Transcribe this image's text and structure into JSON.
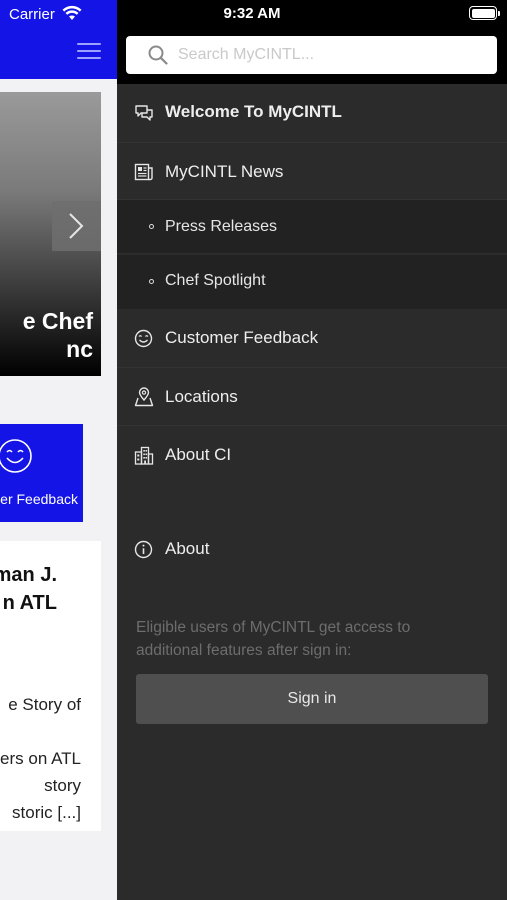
{
  "status_bar": {
    "carrier": "Carrier",
    "time": "9:32 AM"
  },
  "app": {
    "hero": {
      "title_visible": "e Chef\nnc"
    },
    "feedback_tile": {
      "label_visible": "er Feedback",
      "icon": "smile-icon"
    },
    "news_card": {
      "title_visible": "man J.\nn ATL",
      "excerpt_visible": "e Story of\n\ners on ATL\nstory\nstoric [...]"
    },
    "colors": {
      "brand_blue": "#1414e6",
      "header_icon": "#9ea2ff"
    }
  },
  "drawer": {
    "search": {
      "placeholder": "Search MyCINTL..."
    },
    "menu": [
      {
        "label": "Welcome To MyCINTL",
        "icon": "chat-bubbles-icon",
        "bold": true
      },
      {
        "label": "MyCINTL News",
        "icon": "newspaper-icon"
      },
      {
        "label": "Press Releases",
        "sub": true
      },
      {
        "label": "Chef Spotlight",
        "sub": true
      },
      {
        "label": "Customer Feedback",
        "icon": "smile-icon"
      },
      {
        "label": "Locations",
        "icon": "map-pin-icon"
      },
      {
        "label": "About CI",
        "icon": "building-icon"
      },
      {
        "label": "About",
        "icon": "info-icon"
      }
    ],
    "signin": {
      "hint": "Eligible users of MyCINTL get access to additional features after sign in:",
      "button_label": "Sign in"
    },
    "colors": {
      "background": "#2b2b2b",
      "sub_background": "#222222",
      "button": "#4f4f4f"
    }
  }
}
